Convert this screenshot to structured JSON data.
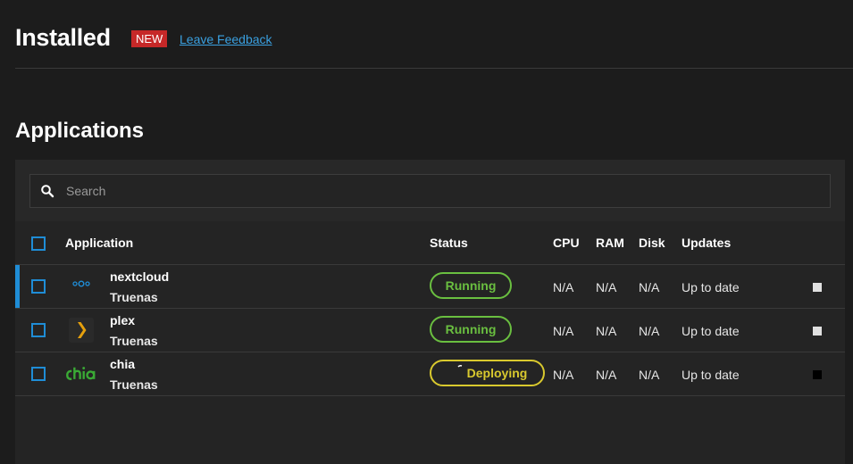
{
  "header": {
    "title": "Installed",
    "badge": "NEW",
    "feedback_link": "Leave Feedback"
  },
  "section": {
    "title": "Applications"
  },
  "search": {
    "placeholder": "Search",
    "value": ""
  },
  "table": {
    "columns": {
      "application": "Application",
      "status": "Status",
      "cpu": "CPU",
      "ram": "RAM",
      "disk": "Disk",
      "updates": "Updates"
    },
    "rows": [
      {
        "name": "nextcloud",
        "train": "Truenas",
        "icon": "nextcloud-logo",
        "status": "Running",
        "status_color": "#6abf40",
        "cpu": "N/A",
        "ram": "N/A",
        "disk": "N/A",
        "updates": "Up to date",
        "action_icon": "stop-icon"
      },
      {
        "name": "plex",
        "train": "Truenas",
        "icon": "plex-logo",
        "status": "Running",
        "status_color": "#6abf40",
        "cpu": "N/A",
        "ram": "N/A",
        "disk": "N/A",
        "updates": "Up to date",
        "action_icon": "stop-icon"
      },
      {
        "name": "chia",
        "train": "Truenas",
        "icon": "chia-logo",
        "status": "Deploying",
        "status_color": "#d9c92e",
        "cpu": "N/A",
        "ram": "N/A",
        "disk": "N/A",
        "updates": "Up to date",
        "action_icon": "stop-icon"
      }
    ]
  },
  "colors": {
    "accent": "#1f8dd6",
    "running": "#6abf40",
    "deploying": "#d9c92e",
    "new_badge": "#c62828",
    "link": "#3aa0e0"
  }
}
